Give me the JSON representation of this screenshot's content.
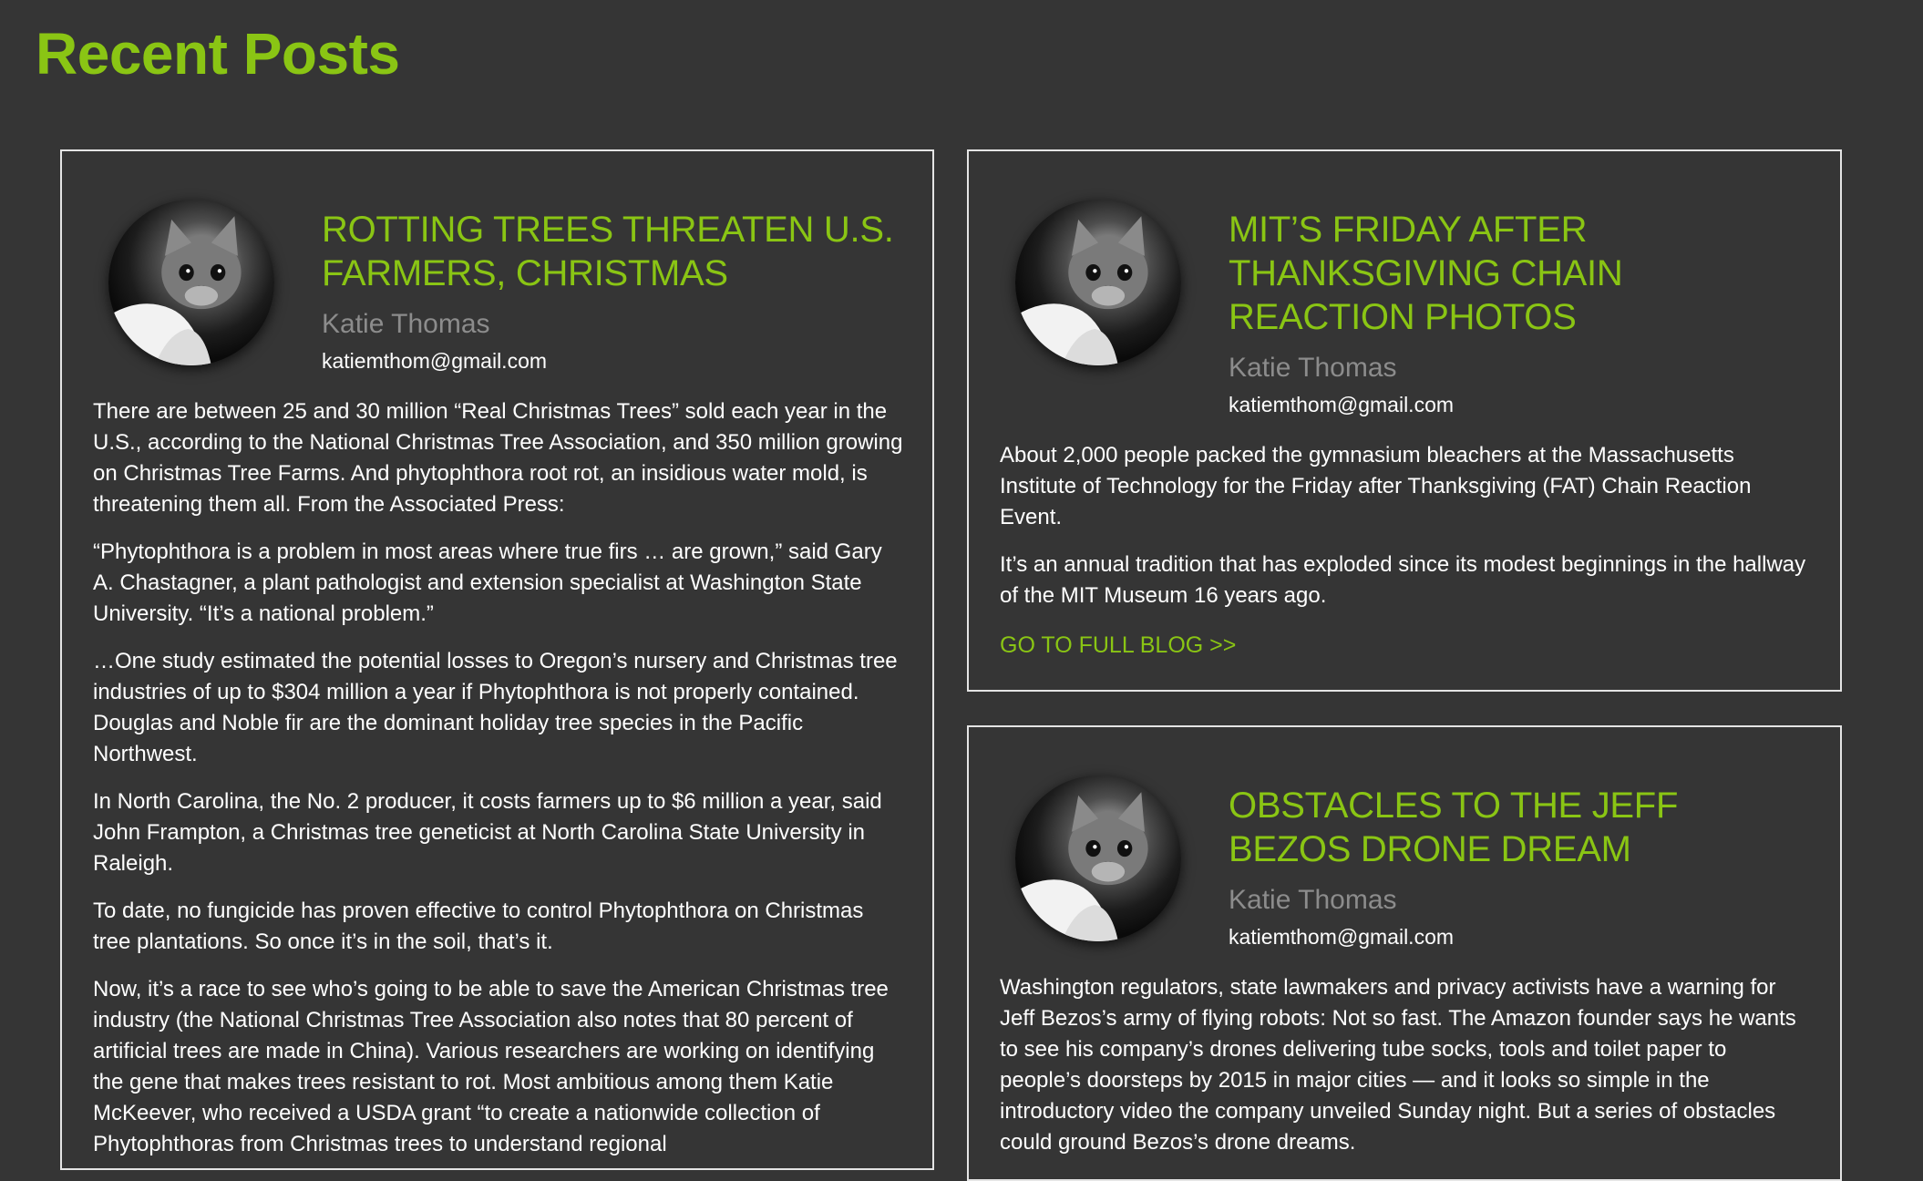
{
  "page": {
    "title": "Recent Posts"
  },
  "posts": [
    {
      "title": "ROTTING TREES THREATEN U.S. FARMERS, CHRISTMAS",
      "author": "Katie Thomas",
      "email": "katiemthom@gmail.com",
      "paragraphs": [
        "There are between 25 and 30 million “Real Christmas Trees” sold each year in the U.S., according to the National Christmas Tree Association, and 350 million growing on Christmas Tree Farms. And phytophthora root rot, an insidious water mold, is threatening them all. From the Associated Press:",
        "“Phytophthora is a problem in most areas where true firs … are grown,” said Gary A. Chastagner, a plant pathologist and extension specialist at Washington State University. “It’s a national problem.”",
        "…One study estimated the potential losses to Oregon’s nursery and Christmas tree industries of up to $304 million a year if Phytophthora is not properly contained. Douglas and Noble fir are the dominant holiday tree species in the Pacific Northwest.",
        "In North Carolina, the No. 2 producer, it costs farmers up to $6 million a year, said John Frampton, a Christmas tree geneticist at North Carolina State University in Raleigh.",
        "To date, no fungicide has proven effective to control Phytophthora on Christmas tree plantations. So once it’s in the soil, that’s it.",
        "Now, it’s a race to see who’s going to be able to save the American Christmas tree industry (the National Christmas Tree Association also notes that 80 percent of artificial trees are made in China). Various researchers are working on identifying the gene that makes trees resistant to rot. Most ambitious among them Katie McKeever, who received a USDA grant “to create a nationwide collection of Phytophthoras from Christmas trees to understand regional"
      ]
    },
    {
      "title": "MIT’S FRIDAY AFTER THANKSGIVING CHAIN REACTION PHOTOS",
      "author": "Katie Thomas",
      "email": "katiemthom@gmail.com",
      "paragraphs": [
        "About 2,000 people packed the gymnasium bleachers at the Massachusetts Institute of Technology for the Friday after Thanksgiving (FAT) Chain Reaction Event.",
        "It’s an annual tradition that has exploded since its modest beginnings in the hallway of the MIT Museum 16 years ago."
      ],
      "read_more": "GO TO FULL BLOG >>"
    },
    {
      "title": "OBSTACLES TO THE JEFF BEZOS DRONE DREAM",
      "author": "Katie Thomas",
      "email": "katiemthom@gmail.com",
      "paragraphs": [
        "Washington regulators, state lawmakers and privacy activists have a warning for Jeff Bezos’s army of flying robots: Not so fast. The Amazon founder says he wants to see his company’s drones delivering tube socks, tools and toilet paper to people’s doorsteps by 2015 in major cities — and it looks so simple in the introductory video the company unveiled Sunday night. But a series of obstacles could ground Bezos’s drone dreams."
      ]
    }
  ],
  "colors": {
    "background": "#353535",
    "accent": "#8ac514",
    "author": "#8c8c8c",
    "text": "#ffffff",
    "border": "#e4e4e4"
  },
  "icons": {
    "avatar": "kitten-avatar"
  }
}
